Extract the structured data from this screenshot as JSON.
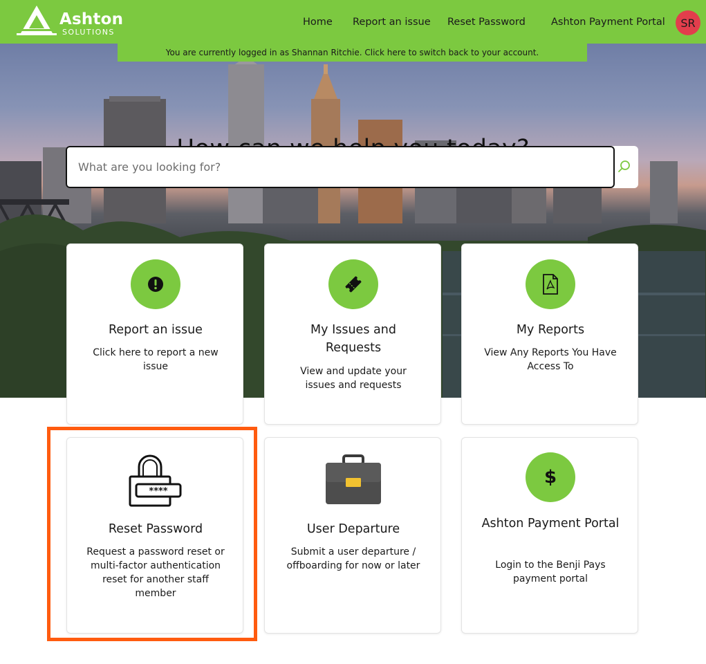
{
  "brand": {
    "name": "Ashton",
    "sub": "SOLUTIONS"
  },
  "nav": {
    "items": [
      {
        "label": "Home"
      },
      {
        "label": "Report an issue"
      },
      {
        "label": "Reset Password"
      },
      {
        "label": "Ashton Payment Portal"
      }
    ],
    "avatar_initials": "SR"
  },
  "banner": {
    "text": "You are currently logged in as Shannan Ritchie. Click here to switch back to your account."
  },
  "hero": {
    "title": "How can we help you today?"
  },
  "search": {
    "placeholder": "What are you looking for?",
    "value": "",
    "icon": "search-icon"
  },
  "cards": [
    {
      "title": "Report an issue",
      "desc": "Click here to report a new issue",
      "icon": "exclamation-icon"
    },
    {
      "title": "My Issues and Requests",
      "desc": "View and update your issues and requests",
      "icon": "ticket-icon"
    },
    {
      "title": "My Reports",
      "desc": "View Any Reports You Have Access To",
      "icon": "pdf-file-icon"
    },
    {
      "title": "Reset Password",
      "desc": "Request a password reset or multi-factor authentication reset for another staff member",
      "icon": "padlock-password-icon"
    },
    {
      "title": "User Departure",
      "desc": "Submit a user departure / offboarding for now or later",
      "icon": "briefcase-icon"
    },
    {
      "title": "Ashton Payment Portal",
      "desc": "Login to the Benji Pays payment portal",
      "icon": "dollar-icon"
    }
  ],
  "colors": {
    "accent": "#7cc940",
    "avatar": "#e23e4c",
    "highlight": "#ff5b0f"
  }
}
